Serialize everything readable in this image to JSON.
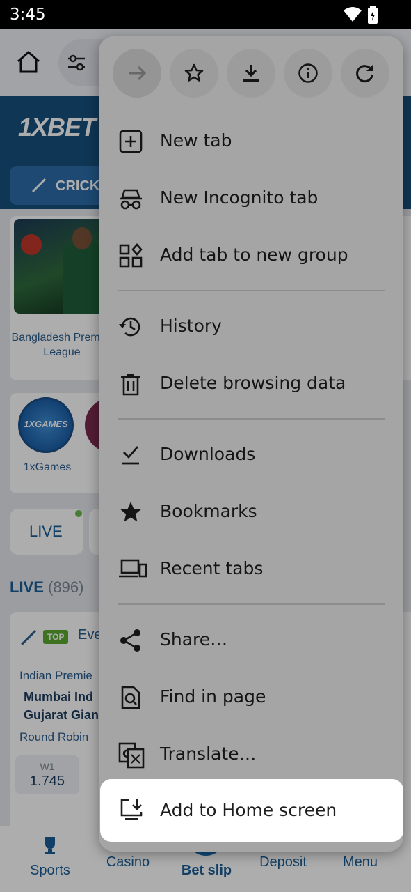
{
  "status_bar": {
    "time": "3:45"
  },
  "site": {
    "logo": "1XBET",
    "sport_tab": "CRICKET",
    "banner_caption": "Bangladesh Premier League",
    "games_label": "1xGames",
    "games_logo": "1XGAMES",
    "live_pill": "LIVE",
    "live_title": "LIVE",
    "live_count": "(896)",
    "match": {
      "badge": "TOP",
      "event_fragment": "Eve",
      "league": "Indian Premie",
      "team1": "Mumbai Ind",
      "team2": "Gujarat Gian",
      "round": "Round Robin",
      "odd_label": "W1",
      "odd_value": "1.745"
    }
  },
  "bottom_nav": {
    "items": [
      "Sports",
      "Casino",
      "Bet slip",
      "Deposit",
      "Menu"
    ]
  },
  "menu": {
    "actions": [
      "forward-icon",
      "bookmark-star-icon",
      "download-icon",
      "info-icon",
      "refresh-icon"
    ],
    "items": [
      "New tab",
      "New Incognito tab",
      "Add tab to new group",
      "History",
      "Delete browsing data",
      "Downloads",
      "Bookmarks",
      "Recent tabs",
      "Share…",
      "Find in page",
      "Translate…"
    ],
    "highlighted_item": "Add to Home screen"
  }
}
